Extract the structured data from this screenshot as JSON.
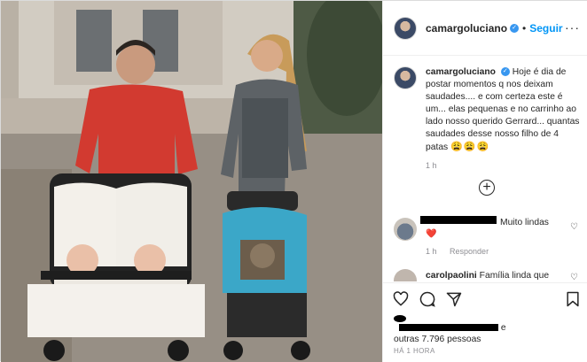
{
  "post": {
    "username": "camargoluciano",
    "follow_label": "Seguir",
    "dot": "•",
    "more_label": "···",
    "verified_mark": "✓"
  },
  "caption": {
    "username": "camargoluciano",
    "text": "Hoje é dia de postar momentos q nos deixam saudades.... e com certeza este é um... elas pequenas e no carrinho ao lado nosso querido Gerrard... quantas saudades desse nosso filho de 4 patas",
    "emojis": "😩😩😩",
    "time": "1 h"
  },
  "load_more": {
    "icon": "plus-circle-icon",
    "label": "+"
  },
  "comments": [
    {
      "text": "Muito lindas",
      "emoji": "❤️",
      "time": "1 h",
      "reply_label": "Responder"
    },
    {
      "username": "carolpaolini",
      "text": "Família linda que"
    }
  ],
  "actions": {
    "icons": [
      "heart-icon",
      "comment-icon",
      "share-icon",
      "bookmark-icon"
    ],
    "likes_suffix": "e",
    "likes_line2": "outras 7.796 pessoas",
    "post_age": "HÁ 1 HORA"
  },
  "colors": {
    "follow": "#0095f6",
    "verified": "#3897f0",
    "muted": "#8e8e93",
    "text": "#262626"
  }
}
